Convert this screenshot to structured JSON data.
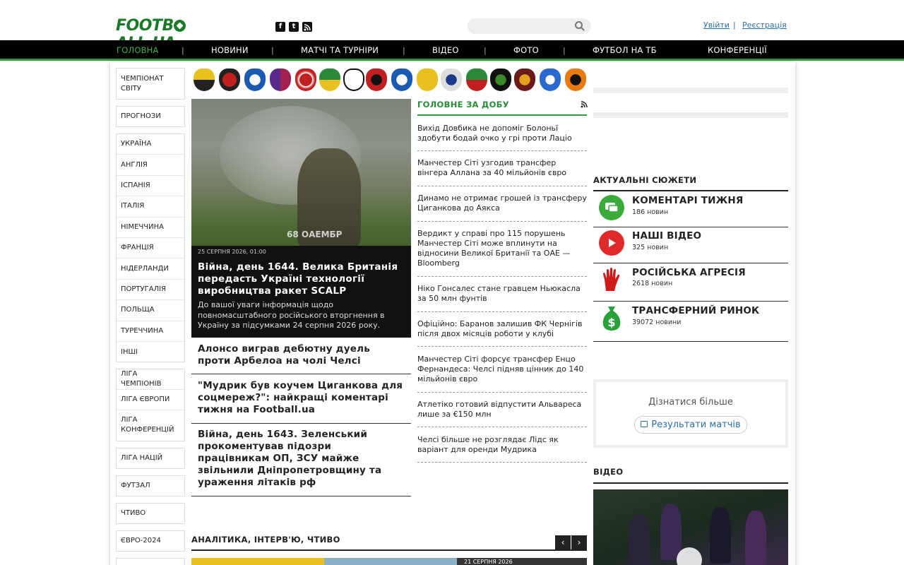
{
  "header": {
    "logo": "FOOTBALL.UA",
    "social": [
      "f",
      "t",
      "rss"
    ],
    "search_placeholder": "",
    "login": "Увійти",
    "register": "Реєстрація",
    "separator": "|"
  },
  "nav": {
    "items": [
      "ГОЛОВНА",
      "НОВИНИ",
      "МАТЧІ ТА ТУРНІРИ",
      "ВІДЕО",
      "ФОТО",
      "ФУТБОЛ НА ТБ",
      "КОНФЕРЕНЦІЇ"
    ],
    "separator": "|"
  },
  "sidebar": {
    "groups": [
      [
        "ЧЕМПІОНАТ СВІТУ"
      ],
      [
        "ПРОГНОЗИ"
      ],
      [
        "УКРАЇНА",
        "АНГЛІЯ",
        "ІСПАНІЯ",
        "ІТАЛІЯ",
        "НІМЕЧЧИНА",
        "ФРАНЦІЯ",
        "НІДЕРЛАНДИ",
        "ПОРТУГАЛІЯ",
        "ПОЛЬЩА",
        "ТУРЕЧЧИНА",
        "ІНШІ"
      ],
      [
        "ЛІГА ЧЕМПІОНІВ",
        "ЛІГА ЄВРОПИ",
        "ЛІГА КОНФЕРЕНЦІЙ"
      ],
      [
        "ЛІГА НАЦІЙ"
      ],
      [
        "ФУТЗАЛ"
      ],
      [
        "ЧТИВО"
      ],
      [
        "ЄВРО-2024"
      ]
    ]
  },
  "feature": {
    "watermark": "68 ОАЕМБР",
    "date": "25 СЕРПНЯ 2026, 01:00",
    "title": "Війна, день 1644. Велика Британія передасть Україні технології виробництва ракет SCALP",
    "subtitle": "До вашої уваги інформація щодо повномасштабного російського вторгнення в Україну за підсумками 24 серпня 2026 року."
  },
  "stories": [
    "Алонсо виграв дебютну дуель проти Арбелоа на чолі Челсі",
    "\"Мудрик був коучем Циганкова для соцмереж?\": найкращі коментарі тижня на Football.ua",
    "Війна, день 1643. Зеленський прокоментував підозри працівникам ОП, ЗСУ майже звільнили Дніпропетровщину та ураження літаків рф"
  ],
  "top_of_day": {
    "title": "ГОЛОВНЕ ЗА ДОБУ",
    "items": [
      "Вихід Довбика не допоміг Болоньї здобути бодай очко у грі проти Лаціо",
      "Манчестер Сіті узгодив трансфер вінгера Аллана за 40 мільйонів євро",
      "Динамо не отримає грошей із трансферу Циганкова до Аякса",
      "Вердикт у справі про 115 порушень Манчестер Сіті може вплинути на відносини Великої Британії та ОАЕ — Bloomberg",
      "Ніко Гонсалес стане гравцем Ньюкасла за 50 млн фунтів",
      "Офіційно: Баранов залишив ФК Чернігів після двох місяців роботи у клубі",
      "Манчестер Сіті форсує трансфер Енцо Фернандеса: Челсі підняв цінник до 140 мільйонів євро",
      "Атлетіко готовий відпустити Альвареса лише за €150 млн",
      "Челсі більше не розглядає Лідс як варіант для оренди Мудрика"
    ]
  },
  "topics": {
    "title": "АКТУАЛЬНІ СЮЖЕТИ",
    "items": [
      {
        "name": "КОМЕНТАРІ ТИЖНЯ",
        "count": "186 новин"
      },
      {
        "name": "НАШІ ВІДЕО",
        "count": "325 новин"
      },
      {
        "name": "РОСІЙСЬКА АГРЕСІЯ",
        "count": "2618 новин"
      },
      {
        "name": "ТРАНСФЕРНИЙ РИНОК",
        "count": "39072 новини"
      }
    ]
  },
  "learn_more": {
    "label": "Дізнатися більше",
    "button": "Результати матчів"
  },
  "video": {
    "title": "ВІДЕО"
  },
  "analytics": {
    "title": "АНАЛІТИКА, ІНТЕРВ'Ю, ЧТИВО",
    "thumb_date": "21 СЕРПНЯ 2026",
    "prev": "‹",
    "next": "›"
  },
  "colors": {
    "brand_green": "#2a9a3a",
    "nav_bg": "#000000",
    "link_blue": "#2a6fb0"
  }
}
